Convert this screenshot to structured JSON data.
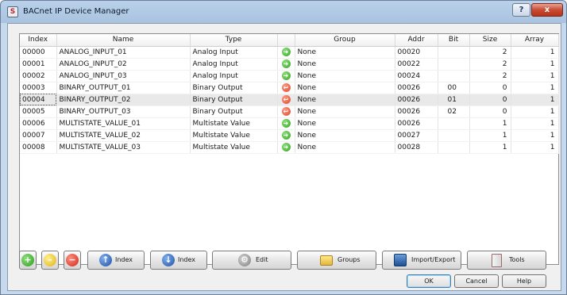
{
  "window": {
    "title": "BACnet IP Device Manager",
    "help_label": "?",
    "close_label": "x"
  },
  "table": {
    "headers": [
      "Index",
      "Name",
      "Type",
      "",
      "Group",
      "Addr",
      "Bit",
      "Size",
      "Array"
    ],
    "rows": [
      {
        "index": "00000",
        "name": "ANALOG_INPUT_01",
        "type": "Analog Input",
        "dir": "in",
        "group": "None",
        "addr": "00020",
        "bit": "",
        "size": "2",
        "array": "1"
      },
      {
        "index": "00001",
        "name": "ANALOG_INPUT_02",
        "type": "Analog Input",
        "dir": "in",
        "group": "None",
        "addr": "00022",
        "bit": "",
        "size": "2",
        "array": "1"
      },
      {
        "index": "00002",
        "name": "ANALOG_INPUT_03",
        "type": "Analog Input",
        "dir": "in",
        "group": "None",
        "addr": "00024",
        "bit": "",
        "size": "2",
        "array": "1"
      },
      {
        "index": "00003",
        "name": "BINARY_OUTPUT_01",
        "type": "Binary Output",
        "dir": "out",
        "group": "None",
        "addr": "00026",
        "bit": "00",
        "size": "0",
        "array": "1"
      },
      {
        "index": "00004",
        "name": "BINARY_OUTPUT_02",
        "type": "Binary Output",
        "dir": "out",
        "group": "None",
        "addr": "00026",
        "bit": "01",
        "size": "0",
        "array": "1"
      },
      {
        "index": "00005",
        "name": "BINARY_OUTPUT_03",
        "type": "Binary Output",
        "dir": "out",
        "group": "None",
        "addr": "00026",
        "bit": "02",
        "size": "0",
        "array": "1"
      },
      {
        "index": "00006",
        "name": "MULTISTATE_VALUE_01",
        "type": "Multistate Value",
        "dir": "in",
        "group": "None",
        "addr": "00026",
        "bit": "",
        "size": "1",
        "array": "1"
      },
      {
        "index": "00007",
        "name": "MULTISTATE_VALUE_02",
        "type": "Multistate Value",
        "dir": "in",
        "group": "None",
        "addr": "00027",
        "bit": "",
        "size": "1",
        "array": "1"
      },
      {
        "index": "00008",
        "name": "MULTISTATE_VALUE_03",
        "type": "Multistate Value",
        "dir": "in",
        "group": "None",
        "addr": "00028",
        "bit": "",
        "size": "1",
        "array": "1"
      }
    ],
    "selected_index": "00004",
    "icons": {
      "in": "arrow-right-circle-icon",
      "out": "arrow-left-circle-icon"
    },
    "colors": {
      "in": "#35a324",
      "out": "#e0452a"
    }
  },
  "toolbar": {
    "index_up_label": "Index",
    "index_down_label": "Index",
    "edit_label": "Edit",
    "groups_label": "Groups",
    "import_export_label": "Import/Export",
    "tools_label": "Tools"
  },
  "dialog": {
    "ok_label": "OK",
    "cancel_label": "Cancel",
    "help_label": "Help"
  }
}
